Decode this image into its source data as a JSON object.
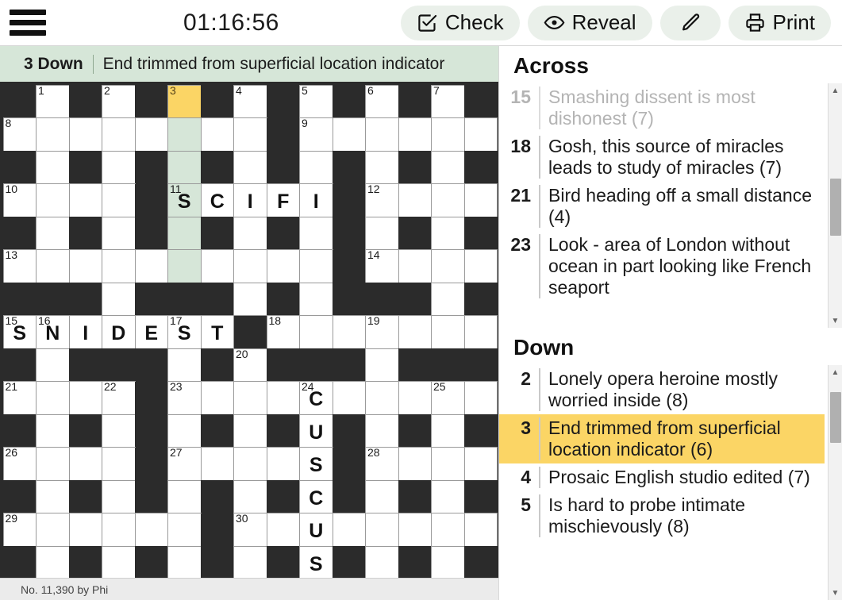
{
  "toolbar": {
    "menu_icon": "hamburger-menu-icon",
    "timer": "01:16:56",
    "check_label": "Check",
    "check_icon": "checkbox-check-icon",
    "reveal_label": "Reveal",
    "reveal_icon": "eye-icon",
    "pencil_icon": "pencil-icon",
    "print_label": "Print",
    "print_icon": "printer-icon"
  },
  "clue_bar": {
    "number": "3 Down",
    "text": "End trimmed from superficial location indicator"
  },
  "footer": {
    "text": "No. 11,390 by Phi"
  },
  "colors": {
    "highlight": "#d6e6d8",
    "cursor": "#fbd565",
    "black_cell": "#2b2b2b",
    "toolbar_button": "#eaf0ea",
    "active_clue": "#fbd565"
  },
  "grid": {
    "size": 15,
    "cells": [
      [
        {
          "t": "b"
        },
        {
          "t": "w",
          "n": "1"
        },
        {
          "t": "b"
        },
        {
          "t": "w",
          "n": "2"
        },
        {
          "t": "b"
        },
        {
          "t": "w",
          "n": "3",
          "s": "cursor"
        },
        {
          "t": "b"
        },
        {
          "t": "w",
          "n": "4"
        },
        {
          "t": "b"
        },
        {
          "t": "w",
          "n": "5"
        },
        {
          "t": "b"
        },
        {
          "t": "w",
          "n": "6"
        },
        {
          "t": "b"
        },
        {
          "t": "w",
          "n": "7"
        },
        {
          "t": "b"
        }
      ],
      [
        {
          "t": "w",
          "n": "8"
        },
        {
          "t": "w"
        },
        {
          "t": "w"
        },
        {
          "t": "w"
        },
        {
          "t": "w"
        },
        {
          "t": "w",
          "s": "hl"
        },
        {
          "t": "w"
        },
        {
          "t": "w"
        },
        {
          "t": "b"
        },
        {
          "t": "w",
          "n": "9"
        },
        {
          "t": "w"
        },
        {
          "t": "w"
        },
        {
          "t": "w"
        },
        {
          "t": "w"
        },
        {
          "t": "w"
        }
      ],
      [
        {
          "t": "b"
        },
        {
          "t": "w"
        },
        {
          "t": "b"
        },
        {
          "t": "w"
        },
        {
          "t": "b"
        },
        {
          "t": "w",
          "s": "hl"
        },
        {
          "t": "b"
        },
        {
          "t": "w"
        },
        {
          "t": "b"
        },
        {
          "t": "w"
        },
        {
          "t": "b"
        },
        {
          "t": "w"
        },
        {
          "t": "b"
        },
        {
          "t": "w"
        },
        {
          "t": "b"
        }
      ],
      [
        {
          "t": "w",
          "n": "10"
        },
        {
          "t": "w"
        },
        {
          "t": "w"
        },
        {
          "t": "w"
        },
        {
          "t": "b"
        },
        {
          "t": "w",
          "n": "11",
          "l": "S",
          "s": "hl"
        },
        {
          "t": "w",
          "l": "C"
        },
        {
          "t": "w",
          "l": "I"
        },
        {
          "t": "w",
          "l": "F"
        },
        {
          "t": "w",
          "l": "I"
        },
        {
          "t": "b"
        },
        {
          "t": "w",
          "n": "12"
        },
        {
          "t": "w"
        },
        {
          "t": "w"
        },
        {
          "t": "w"
        }
      ],
      [
        {
          "t": "b"
        },
        {
          "t": "w"
        },
        {
          "t": "b"
        },
        {
          "t": "w"
        },
        {
          "t": "b"
        },
        {
          "t": "w",
          "s": "hl"
        },
        {
          "t": "b"
        },
        {
          "t": "w"
        },
        {
          "t": "b"
        },
        {
          "t": "w"
        },
        {
          "t": "b"
        },
        {
          "t": "w"
        },
        {
          "t": "b"
        },
        {
          "t": "w"
        },
        {
          "t": "b"
        }
      ],
      [
        {
          "t": "w",
          "n": "13"
        },
        {
          "t": "w"
        },
        {
          "t": "w"
        },
        {
          "t": "w"
        },
        {
          "t": "w"
        },
        {
          "t": "w",
          "s": "hl"
        },
        {
          "t": "w"
        },
        {
          "t": "w"
        },
        {
          "t": "w"
        },
        {
          "t": "w"
        },
        {
          "t": "b"
        },
        {
          "t": "w",
          "n": "14"
        },
        {
          "t": "w"
        },
        {
          "t": "w"
        },
        {
          "t": "w"
        }
      ],
      [
        {
          "t": "b"
        },
        {
          "t": "b"
        },
        {
          "t": "b"
        },
        {
          "t": "w"
        },
        {
          "t": "b"
        },
        {
          "t": "b"
        },
        {
          "t": "b"
        },
        {
          "t": "w"
        },
        {
          "t": "b"
        },
        {
          "t": "w"
        },
        {
          "t": "b"
        },
        {
          "t": "b"
        },
        {
          "t": "b"
        },
        {
          "t": "w"
        },
        {
          "t": "b"
        }
      ],
      [
        {
          "t": "w",
          "n": "15",
          "l": "S"
        },
        {
          "t": "w",
          "n": "16",
          "l": "N"
        },
        {
          "t": "w",
          "l": "I"
        },
        {
          "t": "w",
          "l": "D"
        },
        {
          "t": "w",
          "l": "E"
        },
        {
          "t": "w",
          "n": "17",
          "l": "S"
        },
        {
          "t": "w",
          "l": "T"
        },
        {
          "t": "b"
        },
        {
          "t": "w",
          "n": "18"
        },
        {
          "t": "w"
        },
        {
          "t": "w"
        },
        {
          "t": "w",
          "n": "19"
        },
        {
          "t": "w"
        },
        {
          "t": "w"
        },
        {
          "t": "w"
        }
      ],
      [
        {
          "t": "b"
        },
        {
          "t": "w"
        },
        {
          "t": "b"
        },
        {
          "t": "b"
        },
        {
          "t": "b"
        },
        {
          "t": "w"
        },
        {
          "t": "b"
        },
        {
          "t": "w",
          "n": "20"
        },
        {
          "t": "b"
        },
        {
          "t": "b"
        },
        {
          "t": "b"
        },
        {
          "t": "w"
        },
        {
          "t": "b"
        },
        {
          "t": "b"
        },
        {
          "t": "b"
        }
      ],
      [
        {
          "t": "w",
          "n": "21"
        },
        {
          "t": "w"
        },
        {
          "t": "w"
        },
        {
          "t": "w",
          "n": "22"
        },
        {
          "t": "b"
        },
        {
          "t": "w",
          "n": "23"
        },
        {
          "t": "w"
        },
        {
          "t": "w"
        },
        {
          "t": "w"
        },
        {
          "t": "w",
          "n": "24",
          "l": "C"
        },
        {
          "t": "w"
        },
        {
          "t": "w"
        },
        {
          "t": "w"
        },
        {
          "t": "w",
          "n": "25"
        },
        {
          "t": "w"
        }
      ],
      [
        {
          "t": "b"
        },
        {
          "t": "w"
        },
        {
          "t": "b"
        },
        {
          "t": "w"
        },
        {
          "t": "b"
        },
        {
          "t": "w"
        },
        {
          "t": "b"
        },
        {
          "t": "w"
        },
        {
          "t": "b"
        },
        {
          "t": "w",
          "l": "U"
        },
        {
          "t": "b"
        },
        {
          "t": "w"
        },
        {
          "t": "b"
        },
        {
          "t": "w"
        },
        {
          "t": "b"
        }
      ],
      [
        {
          "t": "w",
          "n": "26"
        },
        {
          "t": "w"
        },
        {
          "t": "w"
        },
        {
          "t": "w"
        },
        {
          "t": "b"
        },
        {
          "t": "w",
          "n": "27"
        },
        {
          "t": "w"
        },
        {
          "t": "w"
        },
        {
          "t": "w"
        },
        {
          "t": "w",
          "l": "S"
        },
        {
          "t": "b"
        },
        {
          "t": "w",
          "n": "28"
        },
        {
          "t": "w"
        },
        {
          "t": "w"
        },
        {
          "t": "w"
        }
      ],
      [
        {
          "t": "b"
        },
        {
          "t": "w"
        },
        {
          "t": "b"
        },
        {
          "t": "w"
        },
        {
          "t": "b"
        },
        {
          "t": "w"
        },
        {
          "t": "b"
        },
        {
          "t": "w"
        },
        {
          "t": "b"
        },
        {
          "t": "w",
          "l": "C"
        },
        {
          "t": "b"
        },
        {
          "t": "w"
        },
        {
          "t": "b"
        },
        {
          "t": "w"
        },
        {
          "t": "b"
        }
      ],
      [
        {
          "t": "w",
          "n": "29"
        },
        {
          "t": "w"
        },
        {
          "t": "w"
        },
        {
          "t": "w"
        },
        {
          "t": "w"
        },
        {
          "t": "w"
        },
        {
          "t": "b"
        },
        {
          "t": "w",
          "n": "30"
        },
        {
          "t": "w"
        },
        {
          "t": "w",
          "l": "U"
        },
        {
          "t": "w"
        },
        {
          "t": "w"
        },
        {
          "t": "w"
        },
        {
          "t": "w"
        },
        {
          "t": "w"
        }
      ],
      [
        {
          "t": "b"
        },
        {
          "t": "w"
        },
        {
          "t": "b"
        },
        {
          "t": "w"
        },
        {
          "t": "b"
        },
        {
          "t": "w"
        },
        {
          "t": "b"
        },
        {
          "t": "w"
        },
        {
          "t": "b"
        },
        {
          "t": "w",
          "l": "S"
        },
        {
          "t": "b"
        },
        {
          "t": "w"
        },
        {
          "t": "b"
        },
        {
          "t": "w"
        },
        {
          "t": "b"
        }
      ]
    ]
  },
  "clues": {
    "across": {
      "title": "Across",
      "items": [
        {
          "num": "15",
          "text": "Smashing dissent is most dishonest (7)",
          "state": "done"
        },
        {
          "num": "18",
          "text": "Gosh, this source of miracles leads to study of miracles (7)",
          "state": "normal"
        },
        {
          "num": "21",
          "text": "Bird heading off a small distance (4)",
          "state": "normal"
        },
        {
          "num": "23",
          "text": "Look - area of London without ocean in part looking like French seaport",
          "state": "normal"
        }
      ]
    },
    "down": {
      "title": "Down",
      "items": [
        {
          "num": "2",
          "text": "Lonely opera heroine mostly worried inside (8)",
          "state": "normal"
        },
        {
          "num": "3",
          "text": "End trimmed from superficial location indicator (6)",
          "state": "active"
        },
        {
          "num": "4",
          "text": "Prosaic English studio edited (7)",
          "state": "normal"
        },
        {
          "num": "5",
          "text": "Is hard to probe intimate mischievously (8)",
          "state": "normal"
        }
      ]
    }
  }
}
